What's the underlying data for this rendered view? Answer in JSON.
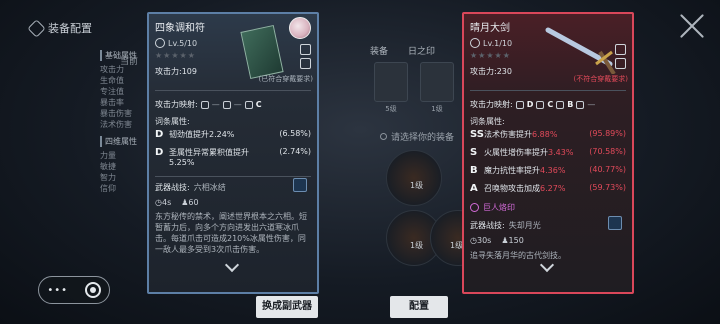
{
  "header": {
    "title": "装备配置"
  },
  "background": {
    "current_label": "当前",
    "attr_panel": {
      "sections": [
        {
          "title": "基础属性",
          "items": [
            "攻击力",
            "生命值",
            "专注值",
            "暴击率",
            "暴击伤害",
            "法术伤害"
          ]
        },
        {
          "title": "四维属性",
          "items": [
            "力量",
            "敏捷",
            "智力",
            "信仰"
          ]
        }
      ]
    },
    "mid": {
      "tabs": [
        "装备",
        "日之印"
      ],
      "slots": [
        {
          "level": "5级"
        },
        {
          "level": "1级"
        }
      ],
      "hint": "请选择你的装备",
      "weapons": [
        {
          "level": "1级"
        },
        {
          "level": "1级"
        },
        {
          "level": "1级"
        }
      ]
    }
  },
  "left_card": {
    "name": "四象调和符",
    "level": "Lv.5/10",
    "stars": "★★★★★",
    "attack": "攻击力:109",
    "requirement": "(已符合穿戴要求)",
    "attack_mapping": {
      "label": "攻击力映射:",
      "g1": "—",
      "g2": "—",
      "g3": "C"
    },
    "attributes_title": "词条属性:",
    "attributes": [
      {
        "grade": "D",
        "text": "韧劲值提升2.24%",
        "value": "(6.58%)"
      },
      {
        "grade": "D",
        "text": "圣属性异常累积值提升5.25%",
        "value": "(2.74%)"
      }
    ],
    "skill": {
      "label": "武器战技:",
      "name": "六相冰结"
    },
    "cooldown": "4s",
    "cost": "60",
    "description": "东方秘传的禁术，阐述世界根本之六相。短暂蓄力后，向多个方向进发出六道寒冰爪击。每道爪击可造成210%冰属性伤害，同一敌人最多受到3次爪击伤害。"
  },
  "right_card": {
    "name": "晴月大剑",
    "level": "Lv.1/10",
    "stars": "★★★★★",
    "attack": "攻击力:230",
    "requirement": "(不符合穿戴要求)",
    "attack_mapping": {
      "label": "攻击力映射:",
      "g1": "D",
      "g2": "C",
      "g3": "B",
      "g4": "—"
    },
    "attributes_title": "词条属性:",
    "attributes": [
      {
        "grade": "SS",
        "text": "法术伤害提升",
        "highlight": "6.88%",
        "value": "(95.89%)"
      },
      {
        "grade": "S",
        "text": "火属性增伤率提升",
        "highlight": "3.43%",
        "value": "(70.58%)"
      },
      {
        "grade": "B",
        "text": "魔力抗性率提升",
        "highlight": "4.36%",
        "value": "(40.77%)"
      },
      {
        "grade": "A",
        "text": "召唤物攻击加成",
        "highlight": "6.27%",
        "value": "(59.73%)"
      }
    ],
    "special": "巨人烙印",
    "skill": {
      "label": "武器战技:",
      "name": "失却月光"
    },
    "cooldown": "30s",
    "cost": "150",
    "description": "追寻失落月华的古代剑技。"
  },
  "buttons": {
    "equip_secondary": "换成副武器",
    "configure": "配置"
  },
  "colors": {
    "left_frame": "#5d7fa6",
    "right_frame": "#d9475a",
    "red_text": "#e24a5a",
    "purple": "#d36bd8"
  }
}
